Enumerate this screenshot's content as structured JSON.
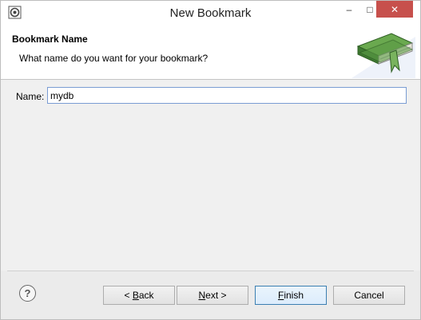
{
  "window": {
    "title": "New Bookmark",
    "controls": {
      "minimize": "–",
      "maximize": "□",
      "close": "✕"
    }
  },
  "header": {
    "title": "Bookmark Name",
    "description": "What name do you want for your bookmark?"
  },
  "form": {
    "name_label": "Name:",
    "name_value": "mydb"
  },
  "footer": {
    "help": "?",
    "back_pre": "< ",
    "back_key": "B",
    "back_post": "ack",
    "next_key": "N",
    "next_post": "ext >",
    "finish_key": "F",
    "finish_post": "inish",
    "cancel": "Cancel"
  },
  "colors": {
    "close_button": "#c7504c",
    "book_green": "#4d8a3d",
    "input_border": "#7a9cd3",
    "default_button_border": "#3c7fb1"
  }
}
